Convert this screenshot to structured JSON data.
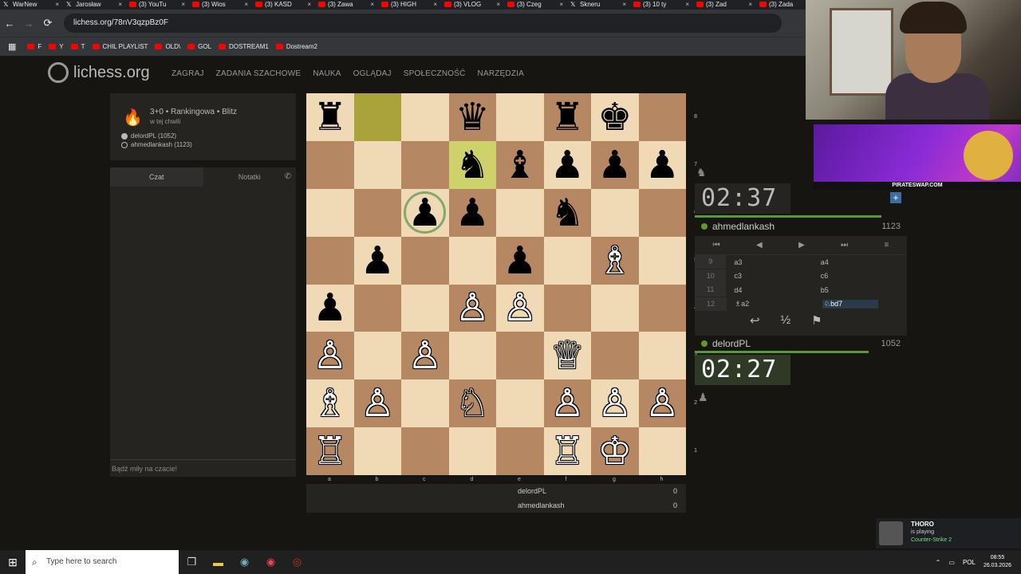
{
  "browser": {
    "tabs": [
      {
        "label": "WarNew",
        "icon": "x"
      },
      {
        "label": "Jarosław",
        "icon": "x"
      },
      {
        "label": "(3) YouTu",
        "icon": "yt"
      },
      {
        "label": "(3) Wios",
        "icon": "yt"
      },
      {
        "label": "(3) KASD",
        "icon": "yt"
      },
      {
        "label": "(3) Zawa",
        "icon": "yt"
      },
      {
        "label": "(3) HIGH",
        "icon": "yt"
      },
      {
        "label": "(3) VLOG",
        "icon": "yt"
      },
      {
        "label": "(3) Czeg",
        "icon": "yt"
      },
      {
        "label": "Skneru",
        "icon": "x"
      },
      {
        "label": "(3) 10 ty",
        "icon": "yt"
      },
      {
        "label": "(3) Zad",
        "icon": "yt"
      },
      {
        "label": "(3) Zada",
        "icon": "yt"
      }
    ],
    "url": "lichess.org/78nV3qzpBz0F",
    "bookmarks": [
      {
        "label": "F"
      },
      {
        "label": "Y"
      },
      {
        "label": "T"
      },
      {
        "label": "CHIL PLAYLIST"
      },
      {
        "label": "OLD\\"
      },
      {
        "label": "GOL"
      },
      {
        "label": "DOSTREAM1"
      },
      {
        "label": "Dostream2"
      }
    ]
  },
  "lichess": {
    "logo": "lichess.org",
    "nav": [
      "ZAGRAJ",
      "ZADANIA SZACHOWE",
      "NAUKA",
      "OGLĄDAJ",
      "SPOŁECZNOŚĆ",
      "NARZĘDZIA"
    ],
    "game": {
      "type": "3+0 • Rankingowa • Blitz",
      "when": "w tej chwili",
      "white": "delordPL (1052)",
      "black": "ahmedlankash (1123)"
    },
    "chat": {
      "tab_chat": "Czat",
      "tab_notes": "Notatki",
      "hint": "Bądź miły na czacie!"
    },
    "board": {
      "ranks": [
        "8",
        "7",
        "6",
        "5",
        "4",
        "3",
        "2",
        "1"
      ],
      "files": [
        "a",
        "b",
        "c",
        "d",
        "e",
        "f",
        "g",
        "h"
      ],
      "rows": [
        [
          [
            "b",
            "♜"
          ],
          null,
          null,
          [
            "b",
            "♛"
          ],
          null,
          [
            "b",
            "♜"
          ],
          [
            "b",
            "♚"
          ],
          null
        ],
        [
          null,
          null,
          null,
          [
            "b",
            "♞"
          ],
          [
            "b",
            "♝"
          ],
          [
            "b",
            "♟"
          ],
          [
            "b",
            "♟"
          ],
          [
            "b",
            "♟"
          ]
        ],
        [
          null,
          null,
          [
            "b",
            "♟"
          ],
          [
            "b",
            "♟"
          ],
          null,
          [
            "b",
            "♞"
          ],
          null,
          null
        ],
        [
          null,
          [
            "b",
            "♟"
          ],
          null,
          null,
          [
            "b",
            "♟"
          ],
          null,
          [
            "w",
            "♗"
          ],
          null
        ],
        [
          [
            "b",
            "♟"
          ],
          null,
          null,
          [
            "w",
            "♙"
          ],
          [
            "w",
            "♙"
          ],
          null,
          null,
          null
        ],
        [
          [
            "w",
            "♙"
          ],
          null,
          [
            "w",
            "♙"
          ],
          null,
          null,
          [
            "w",
            "♕"
          ],
          null,
          null
        ],
        [
          [
            "w",
            "♗"
          ],
          [
            "w",
            "♙"
          ],
          null,
          [
            "w",
            "♘"
          ],
          null,
          [
            "w",
            "♙"
          ],
          [
            "w",
            "♙"
          ],
          [
            "w",
            "♙"
          ]
        ],
        [
          [
            "w",
            "♖"
          ],
          null,
          null,
          null,
          null,
          [
            "w",
            "♖"
          ],
          [
            "w",
            "♔"
          ],
          null
        ]
      ],
      "last_move": [
        "b8",
        "d7"
      ],
      "selected": "c6"
    },
    "material": [
      {
        "name": "delordPL",
        "score": "0"
      },
      {
        "name": "ahmedlankash",
        "score": "0"
      }
    ],
    "top_player": {
      "name": "ahmedlankash",
      "rating": "1123",
      "clock": "02:37",
      "time_fraction": 0.88
    },
    "bottom_player": {
      "name": "delordPL",
      "rating": "1052",
      "clock": "02:27",
      "time_fraction": 0.82
    },
    "moves": [
      {
        "n": "9",
        "w": "a3",
        "b": "a4"
      },
      {
        "n": "10",
        "w": "c3",
        "b": "c6"
      },
      {
        "n": "11",
        "w": "d4",
        "b": "b5"
      },
      {
        "n": "12",
        "w": "♗a2",
        "b": "♘bd7"
      }
    ],
    "move_controls": [
      "⏮",
      "◀",
      "▶",
      "⏭",
      "≡"
    ],
    "actions": [
      "↩",
      "½",
      "⚑"
    ]
  },
  "overlay": {
    "ad_brand": "PIRATESWAP.COM",
    "nowplaying": {
      "name": "THORO",
      "status": "is playing",
      "game": "Counter-Strike 2"
    }
  },
  "taskbar": {
    "search_placeholder": "Type here to search",
    "lang": "POL",
    "time": "08:55",
    "date": "26.03.2026"
  }
}
